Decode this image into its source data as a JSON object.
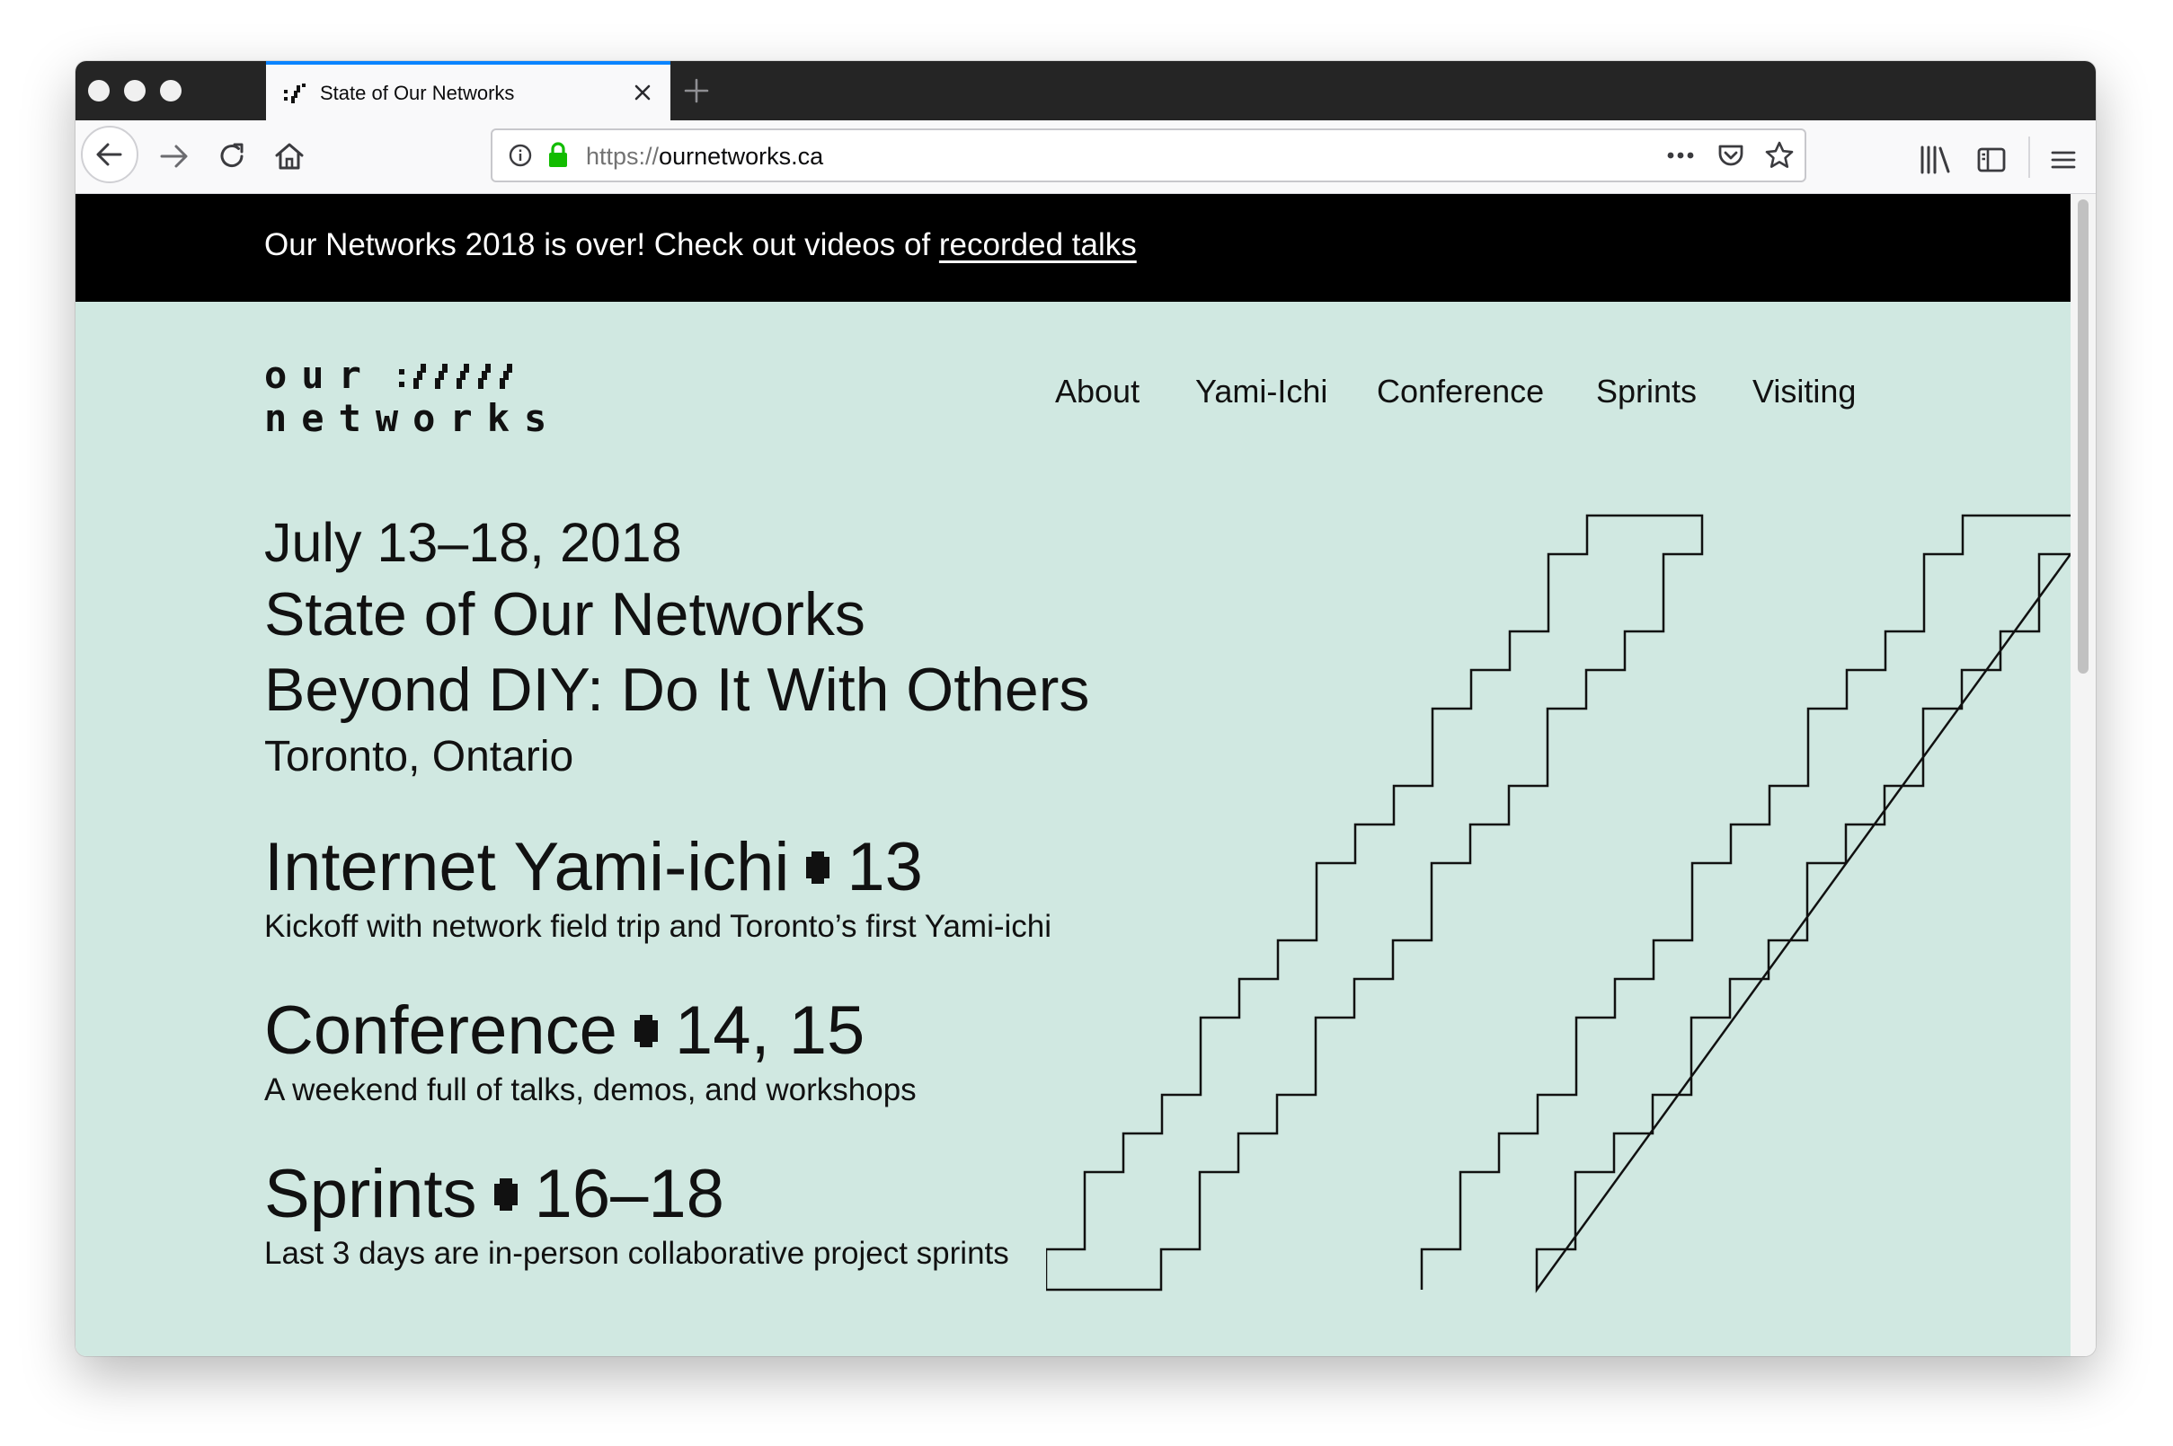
{
  "browser": {
    "tab_title": "State of Our Networks",
    "url_scheme": "https://",
    "url_host": "ournetworks.ca",
    "icons": [
      "back-icon",
      "forward-icon",
      "reload-icon",
      "home-icon",
      "info-icon",
      "lock-icon",
      "more-icon",
      "pocket-icon",
      "bookmark-star-icon",
      "library-icon",
      "sidebar-icon",
      "menu-icon",
      "close-icon",
      "new-tab-icon"
    ]
  },
  "banner": {
    "text": "Our Networks 2018 is over! Check out videos of ",
    "link": "recorded talks"
  },
  "logo": {
    "line1": "our",
    "line2": "networks"
  },
  "nav": {
    "items": [
      "About",
      "Yami-Ichi",
      "Conference",
      "Sprints",
      "Visiting"
    ]
  },
  "hero": {
    "dates": "July 13–18, 2018",
    "title": "State of Our Networks",
    "subtitle": "Beyond DIY: Do It With Others",
    "location": "Toronto, Ontario"
  },
  "events": [
    {
      "name": "Internet Yami-ichi",
      "days": "13",
      "description": "Kickoff with network field trip and Toronto’s first Yami-ichi"
    },
    {
      "name": "Conference",
      "days": "14, 15",
      "description": "A weekend full of talks, demos, and workshops"
    },
    {
      "name": "Sprints",
      "days": "16–18",
      "description": "Last 3 days are in-person collaborative project sprints"
    }
  ],
  "colors": {
    "page_background": "#d0e8e1",
    "banner_background": "#000000",
    "text": "#111111",
    "tab_accent": "#0a84ff",
    "lock_green": "#12bc00"
  }
}
